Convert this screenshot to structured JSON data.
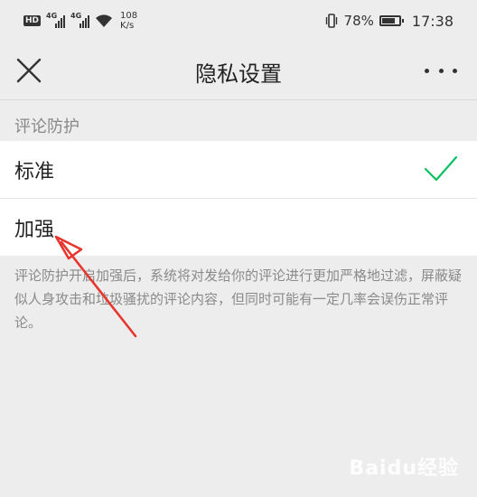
{
  "status_bar": {
    "hd_badge": "HD",
    "sim1_label": "4G",
    "sim2_label": "4G",
    "net_speed_value": "108",
    "net_speed_unit": "K/s",
    "battery_percent": "78%",
    "battery_level": 0.78,
    "time": "17:38"
  },
  "header": {
    "title": "隐私设置",
    "close_icon": "close-icon",
    "more_icon": "more-icon"
  },
  "comment_protection": {
    "section_label": "评论防护",
    "options": [
      {
        "label": "标准",
        "selected": true
      },
      {
        "label": "加强",
        "selected": false
      }
    ],
    "description": "评论防护开启加强后，系统将对发给你的评论进行更加严格地过滤，屏蔽疑似人身攻击和垃圾骚扰的评论内容，但同时可能有一定几率会误伤正常评论。"
  },
  "colors": {
    "accent_green": "#07c160",
    "annotation_red": "#e8352e",
    "background": "#ededed"
  },
  "watermark": "Baidu经验"
}
